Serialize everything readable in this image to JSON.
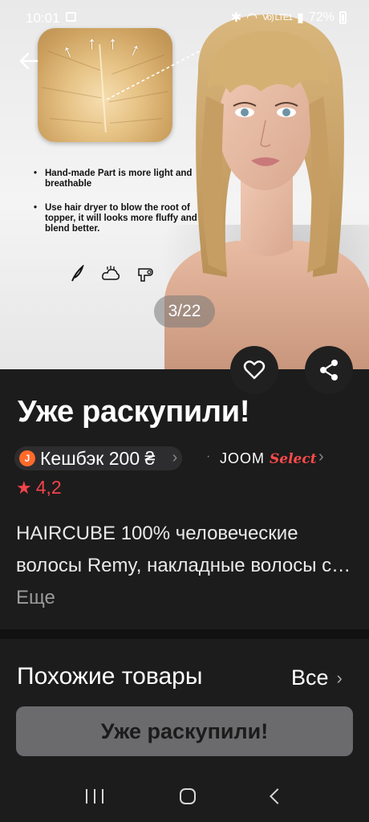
{
  "status_bar": {
    "time": "10:01",
    "network_label": "Vo) LTE1",
    "battery": "72%"
  },
  "gallery": {
    "counter": "3/22",
    "bullets": [
      "Hand-made Part is more light and breathable",
      "Use hair dryer to blow the root of topper, it will looks more fluffy and blend better."
    ],
    "icons": [
      "feather-icon",
      "cloud-icon",
      "hair-dryer-icon"
    ]
  },
  "product": {
    "title": "Уже раскупили!",
    "cashback": "Кешбэк 200 ₴",
    "cashback_badge": "J",
    "joom_brand": "JOOM",
    "joom_select": "Select",
    "rating": "4,2",
    "description": "HAIRCUBE 100% человеческие волосы Remy, накладные волосы с…",
    "more_label": "Еще"
  },
  "similar": {
    "title": "Похожие товары",
    "all_label": "Все"
  },
  "bottom_button": {
    "label": "Уже раскупили!"
  },
  "colors": {
    "background": "#1c1c1c",
    "accent_red": "#f2434b",
    "cashback_orange": "#ff6a2a",
    "disabled_button": "#6b6b6d"
  }
}
